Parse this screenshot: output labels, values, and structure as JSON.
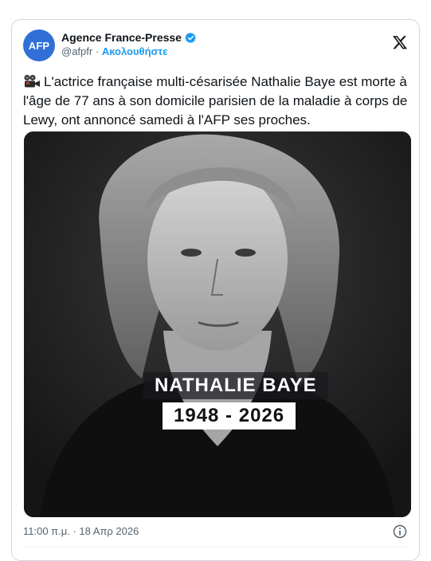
{
  "author": {
    "display_name": "Agence France-Presse",
    "avatar_text": "AFP",
    "handle": "@afpfr",
    "separator": "·",
    "follow_label": "Ακολουθήστε"
  },
  "tweet": {
    "text": "L'actrice française multi-césarisée Nathalie Baye est morte à l'âge de 77 ans à son domicile parisien de la maladie à corps de Lewy, ont annoncé samedi à l'AFP ses proches.",
    "leading_icon": "movie-camera-icon"
  },
  "image": {
    "name_caption": "NATHALIE BAYE",
    "years_caption": "1948 - 2026"
  },
  "footer": {
    "timestamp": "11:00 π.μ. · 18 Απρ 2026"
  },
  "colors": {
    "avatar_bg": "#2f6fd6",
    "verified": "#1d9bf0",
    "link": "#1d9bf0",
    "text": "#0f1419",
    "muted": "#536471"
  }
}
